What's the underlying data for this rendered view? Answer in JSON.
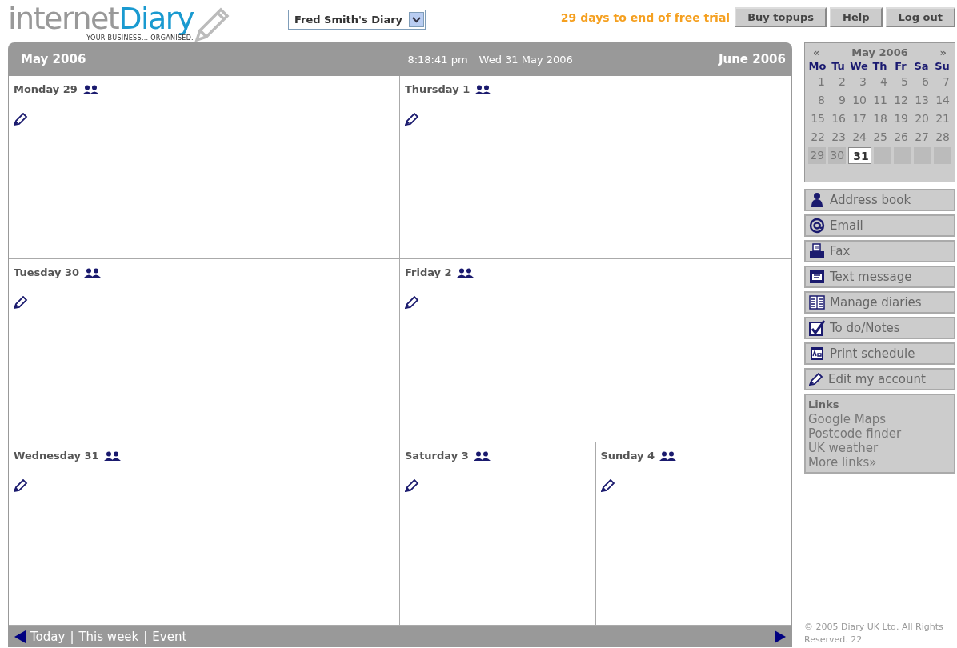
{
  "logo": {
    "word_1": "internet",
    "word_2": "Diary",
    "tagline": "YOUR BUSINESS... ORGANISED."
  },
  "diary_select": {
    "value": "Fred Smith's Diary"
  },
  "trial_notice": "29 days to end of free trial",
  "top_buttons": [
    "Buy topups",
    "Help",
    "Log out"
  ],
  "week_header": {
    "prev_month": "May 2006",
    "clock": "8:18:41 pm",
    "date": "Wed 31 May 2006",
    "next_month": "June 2006"
  },
  "days": [
    {
      "label": "Monday 29"
    },
    {
      "label": "Thursday 1"
    },
    {
      "label": "Tuesday 30"
    },
    {
      "label": "Friday 2"
    },
    {
      "label": "Wednesday 31"
    },
    {
      "label": "Saturday 3"
    },
    {
      "label": "Sunday 4"
    }
  ],
  "footer_nav": {
    "links": [
      "Today",
      "This week",
      "Event"
    ],
    "separator": "|"
  },
  "mini_calendar": {
    "prev": "«",
    "title": "May 2006",
    "next": "»",
    "weekdays": [
      "Mo",
      "Tu",
      "We",
      "Th",
      "Fr",
      "Sa",
      "Su"
    ],
    "weeks": [
      {
        "current": false,
        "days": [
          {
            "day": "1",
            "selected": false
          },
          {
            "day": "2",
            "selected": false
          },
          {
            "day": "3",
            "selected": false
          },
          {
            "day": "4",
            "selected": false
          },
          {
            "day": "5",
            "selected": false
          },
          {
            "day": "6",
            "selected": false
          },
          {
            "day": "7",
            "selected": false
          }
        ]
      },
      {
        "current": false,
        "days": [
          {
            "day": "8",
            "selected": false
          },
          {
            "day": "9",
            "selected": false
          },
          {
            "day": "10",
            "selected": false
          },
          {
            "day": "11",
            "selected": false
          },
          {
            "day": "12",
            "selected": false
          },
          {
            "day": "13",
            "selected": false
          },
          {
            "day": "14",
            "selected": false
          }
        ]
      },
      {
        "current": false,
        "days": [
          {
            "day": "15",
            "selected": false
          },
          {
            "day": "16",
            "selected": false
          },
          {
            "day": "17",
            "selected": false
          },
          {
            "day": "18",
            "selected": false
          },
          {
            "day": "19",
            "selected": false
          },
          {
            "day": "20",
            "selected": false
          },
          {
            "day": "21",
            "selected": false
          }
        ]
      },
      {
        "current": false,
        "days": [
          {
            "day": "22",
            "selected": false
          },
          {
            "day": "23",
            "selected": false
          },
          {
            "day": "24",
            "selected": false
          },
          {
            "day": "25",
            "selected": false
          },
          {
            "day": "26",
            "selected": false
          },
          {
            "day": "27",
            "selected": false
          },
          {
            "day": "28",
            "selected": false
          }
        ]
      },
      {
        "current": true,
        "days": [
          {
            "day": "29",
            "selected": false
          },
          {
            "day": "30",
            "selected": false
          },
          {
            "day": "31",
            "selected": true
          }
        ]
      }
    ]
  },
  "tools": [
    {
      "kind": "person",
      "label": "Address book"
    },
    {
      "kind": "at",
      "label": "Email"
    },
    {
      "kind": "fax",
      "label": "Fax"
    },
    {
      "kind": "sms",
      "label": "Text message"
    },
    {
      "kind": "book",
      "label": "Manage diaries"
    },
    {
      "kind": "check",
      "label": "To do/Notes"
    },
    {
      "kind": "print",
      "label": "Print schedule"
    },
    {
      "kind": "pencil",
      "label": "Edit my account"
    }
  ],
  "links": {
    "title": "Links",
    "items": [
      "Google Maps",
      "Postcode finder",
      "UK weather",
      "More links»"
    ]
  },
  "copyright": "© 2005 Diary UK Ltd. All Rights Reserved. 22"
}
